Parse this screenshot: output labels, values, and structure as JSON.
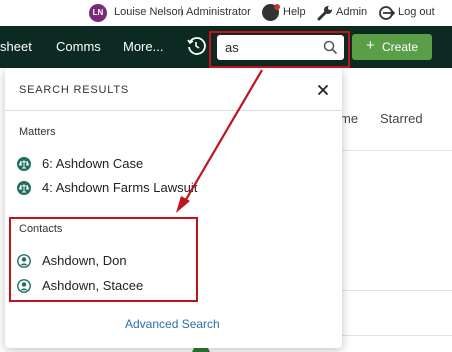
{
  "topbar": {
    "avatar_initials": "LN",
    "user_name": "Louise Nelson",
    "separator": "|",
    "role": "Administrator",
    "help_label": "Help",
    "admin_label": "Admin",
    "logout_label": "Log out"
  },
  "nav": {
    "items": [
      "sheet",
      "Comms",
      "More..."
    ],
    "search_value": "as",
    "create_plus": "+",
    "create_label": "Create"
  },
  "background": {
    "tab_me": "me",
    "tab_starred": "Starred"
  },
  "dropdown": {
    "title": "SEARCH RESULTS",
    "close_icon": "close-icon",
    "sections": [
      {
        "label": "Matters",
        "items": [
          {
            "text": "6: Ashdown Case",
            "icon": "scales-icon"
          },
          {
            "text": "4: Ashdown Farms Lawsuit",
            "icon": "scales-icon"
          }
        ]
      },
      {
        "label": "Contacts",
        "items": [
          {
            "text": "Ashdown, Don",
            "icon": "person-icon"
          },
          {
            "text": "Ashdown, Stacee",
            "icon": "person-icon"
          }
        ]
      }
    ],
    "advanced_search": "Advanced Search"
  },
  "colors": {
    "nav_bg": "#0d2a22",
    "create_green": "#5a9e47",
    "highlight_red": "#c1121f",
    "link_blue": "#2b6fa8",
    "icon_teal": "#1f6e5e"
  }
}
